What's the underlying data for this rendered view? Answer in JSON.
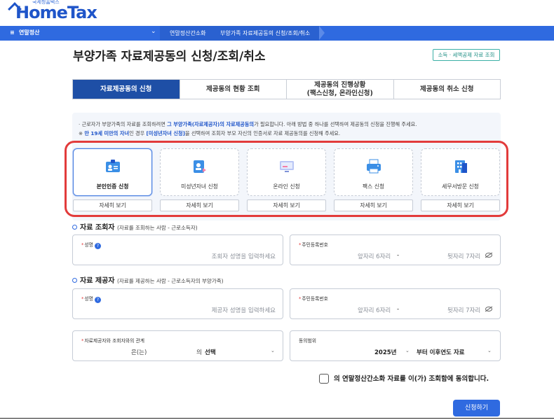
{
  "header": {
    "logo_tag": "국세청홈택스",
    "logo_name": "HomeTax",
    "menu_label": "연말정산",
    "breadcrumbs": [
      "연말정산간소화",
      "부양가족 자료제공동의 신청/조회/취소"
    ]
  },
  "page": {
    "title": "부양가족 자료제공동의 신청/조회/취소",
    "top_link": "소득 · 세액공제 자료 조회"
  },
  "tabs": [
    {
      "label": "자료제공동의 신청",
      "active": true
    },
    {
      "label": "제공동의 현황 조회",
      "active": false
    },
    {
      "label": "제공동의 진행상황\n(팩스신청, 온라인신청)",
      "active": false
    },
    {
      "label": "제공동의 취소 신청",
      "active": false
    }
  ],
  "notice": {
    "line1_a": "· 근로자가 부양가족의 자료를 조회하려면 ",
    "line1_b": "그 부양가족(자료제공자)의 자료제공동의",
    "line1_c": "가 필요합니다. 아래 방법 중 하나를 선택하여 제공동의 신청을 진행해 주세요.",
    "line2_a": "※ ",
    "line2_b": "만 19세 미만의 자녀",
    "line2_c": "인 경우 ",
    "line2_d": "[미성년자녀 신청]",
    "line2_e": "을 선택하여 조회자 부모 자신의 인증서로 자료 제공동의를 신청해 주세요."
  },
  "options": [
    {
      "label": "본인인증 신청",
      "detail": "자세히 보기",
      "icon": "id-card-icon",
      "selected": true
    },
    {
      "label": "미성년자녀 신청",
      "detail": "자세히 보기",
      "icon": "child-document-icon",
      "selected": false
    },
    {
      "label": "온라인 신청",
      "detail": "자세히 보기",
      "icon": "monitor-icon",
      "selected": false
    },
    {
      "label": "팩스 신청",
      "detail": "자세히 보기",
      "icon": "fax-icon",
      "selected": false
    },
    {
      "label": "세무서방문 신청",
      "detail": "자세히 보기",
      "icon": "tax-office-icon",
      "selected": false
    }
  ],
  "viewer": {
    "title": "자료 조회자",
    "subtitle": "(자료를 조회하는 사람 - 근로소득자)",
    "name_label": "성명",
    "name_placeholder": "조회자 성명을 입력하세요",
    "rrn_label": "주민등록번호",
    "rrn_front_placeholder": "앞자리 6자리",
    "rrn_dash": "-",
    "rrn_back_placeholder": "뒷자리 7자리"
  },
  "provider": {
    "title": "자료 제공자",
    "subtitle": "(자료를 제공하는 사람 - 근로소득자의 부양가족)",
    "name_label": "성명",
    "name_placeholder": "제공자 성명을 입력하세요",
    "rrn_label": "주민등록번호",
    "rrn_front_placeholder": "앞자리 6자리",
    "rrn_dash": "-",
    "rrn_back_placeholder": "뒷자리 7자리",
    "relation_label": "자료제공자와 조회자와의 관계",
    "relation_prefix": "은(는)",
    "relation_mid": "의",
    "relation_value": "선택",
    "scope_label": "동의범위",
    "scope_year": "2025년",
    "scope_value": "부터 이후연도 자료"
  },
  "agreement": {
    "text": "의 연말정산간소화 자료를 이(가) 조회함에 동의합니다."
  },
  "submit_label": "신청하기",
  "colors": {
    "primary": "#2f6ae0",
    "tab_active": "#1e4fa6",
    "highlight": "#e23b3b",
    "link": "#1f8f85"
  }
}
